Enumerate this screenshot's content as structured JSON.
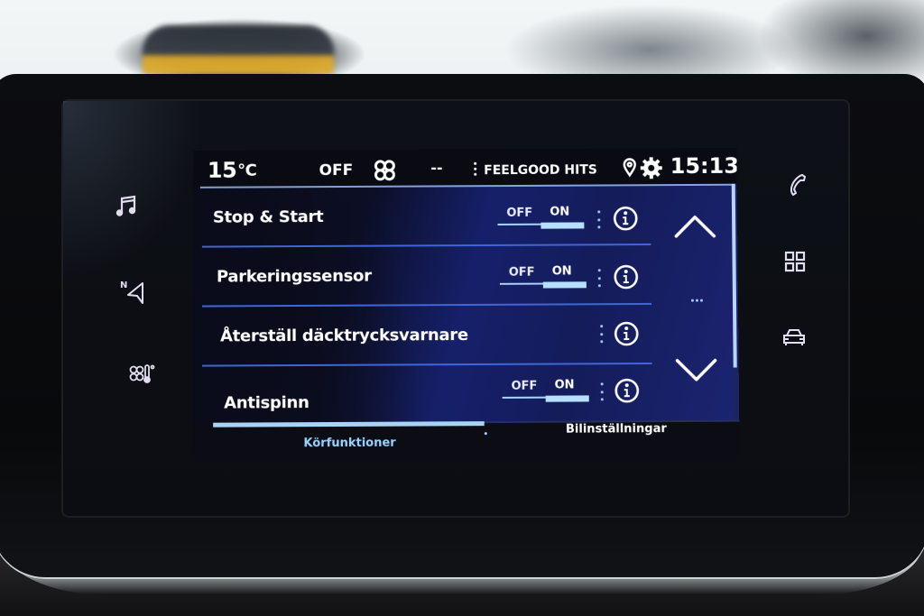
{
  "status_bar": {
    "temperature": "15",
    "temperature_unit": "°C",
    "ac_status": "OFF",
    "fan_icon": "fan-icon",
    "fan_level": "--",
    "media_menu_icon": "kebab-menu-icon",
    "media_source": "FEELGOOD HITS",
    "location_icon": "location-pin-icon",
    "settings_icon": "gear-icon",
    "clock": "15:13"
  },
  "left_hard_keys": [
    {
      "name": "media",
      "icon": "music-note-icon"
    },
    {
      "name": "navigation",
      "icon": "navigation-arrow-icon",
      "badge": "N"
    },
    {
      "name": "climate",
      "icon": "climate-fan-thermometer-icon"
    }
  ],
  "right_hard_keys": [
    {
      "name": "phone",
      "icon": "phone-icon"
    },
    {
      "name": "apps",
      "icon": "grid-apps-icon"
    },
    {
      "name": "vehicle",
      "icon": "car-icon"
    }
  ],
  "settings": {
    "rows": [
      {
        "label": "Stop & Start",
        "has_toggle": true,
        "toggle_off_label": "OFF",
        "toggle_on_label": "ON",
        "state": "ON"
      },
      {
        "label": "Parkeringssensor",
        "has_toggle": true,
        "toggle_off_label": "OFF",
        "toggle_on_label": "ON",
        "state": "ON"
      },
      {
        "label": "Återställ däcktrycksvarnare",
        "has_toggle": false
      },
      {
        "label": "Antispinn",
        "has_toggle": true,
        "toggle_off_label": "OFF",
        "toggle_on_label": "ON",
        "state": "ON"
      }
    ],
    "scroll_up_icon": "chevron-up-icon",
    "scroll_down_icon": "chevron-down-icon",
    "more_icon": "more-dots-icon",
    "scroll_position_fraction": 0.78
  },
  "tabs": [
    {
      "label": "Körfunktioner",
      "active": true
    },
    {
      "label": "Bilinställningar",
      "active": false
    }
  ],
  "colors": {
    "accent_light_blue": "#a9d3f4",
    "divider_blue": "#3f66d8",
    "active_tab_text": "#9ad2ff"
  }
}
